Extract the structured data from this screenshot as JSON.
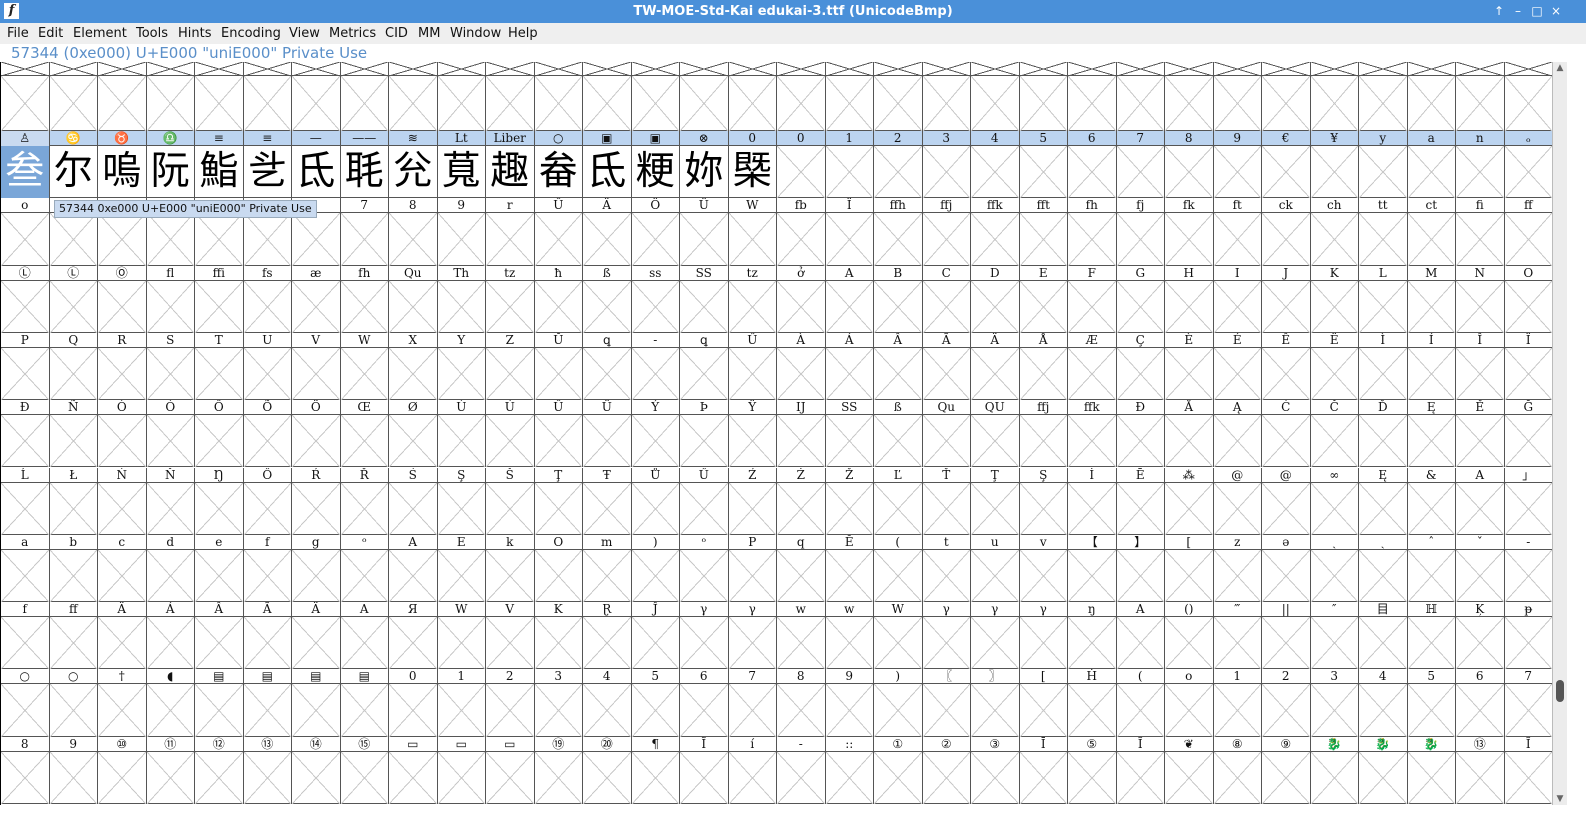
{
  "window": {
    "title": "TW-MOE-Std-Kai  edukai-3.ttf (UnicodeBmp)",
    "app_icon": "f",
    "controls": [
      "↑",
      "–",
      "□",
      "×"
    ]
  },
  "menu": [
    "File",
    "Edit",
    "Element",
    "Tools",
    "Hints",
    "Encoding",
    "View",
    "Metrics",
    "CID",
    "MM",
    "Window",
    "Help"
  ],
  "info_line": "57344 (0xe000) U+E000 \"uniE000\" Private Use",
  "tooltip": "57344 0xe000 U+E000 \"uniE000\" Private Use",
  "selection": {
    "row": 0,
    "col": 0
  },
  "rows": [
    {
      "labels": [
        "♙",
        "♋",
        "♉",
        "♎",
        "≡",
        "≡",
        "—",
        "——",
        "≋",
        "Lt",
        "Liber",
        "○",
        "▣",
        "▣",
        "⊗",
        "0",
        "0",
        "1",
        "2",
        "3",
        "4",
        "5",
        "6",
        "7",
        "8",
        "9",
        "€",
        "¥",
        "y",
        "a",
        "n",
        "ₒ"
      ],
      "glyphs": [
        "叁",
        "尔",
        "嗚",
        "阮",
        "鮨",
        "乧",
        "氐",
        "毦",
        "兊",
        "萈",
        "趣",
        "畚",
        "氐",
        "粳",
        "妳",
        "槩",
        "",
        "",
        "",
        "",
        "",
        "",
        "",
        "",
        "",
        "",
        "",
        "",
        "",
        "",
        "",
        ""
      ]
    },
    {
      "labels": [
        "o",
        "",
        "",
        "",
        "",
        "",
        "",
        "7",
        "8",
        "9",
        "r",
        "Û",
        "Ä",
        "Ö",
        "Ü",
        "W",
        "fb",
        "Ï",
        "ffh",
        "ffj",
        "ffk",
        "fft",
        "fh",
        "fj",
        "fk",
        "ft",
        "ck",
        "ch",
        "tt",
        "ct",
        "fi",
        "ff"
      ]
    },
    {
      "labels": [
        "Ⓛ",
        "Ⓛ",
        "Ⓞ",
        "fl",
        "ffi",
        "fs",
        "æ",
        "fh",
        "Qu",
        "Th",
        "tz",
        "ħ",
        "ß",
        "ss",
        "SS",
        "tz",
        "ở",
        "A",
        "B",
        "C",
        "D",
        "E",
        "F",
        "G",
        "H",
        "I",
        "J",
        "K",
        "L",
        "M",
        "N",
        "O"
      ]
    },
    {
      "labels": [
        "P",
        "Q",
        "R",
        "S",
        "T",
        "U",
        "V",
        "W",
        "X",
        "Y",
        "Z",
        "Ŭ",
        "ꝗ",
        "-",
        "ꝗ",
        "Ű",
        "À",
        "Á",
        "Â",
        "Ã",
        "Ä",
        "Å",
        "Æ",
        "Ç",
        "È",
        "É",
        "Ê",
        "Ë",
        "Ì",
        "Í",
        "Î",
        "Ï"
      ]
    },
    {
      "labels": [
        "Ð",
        "Ñ",
        "Ò",
        "Ó",
        "Ô",
        "Õ",
        "Ö",
        "Œ",
        "Ø",
        "Ù",
        "Ú",
        "Û",
        "Ü",
        "Ý",
        "Þ",
        "Ÿ",
        "IJ",
        "SS",
        "ß",
        "Qu",
        "QU",
        "ffj",
        "ffk",
        "Đ",
        "Ă",
        "Ą",
        "Ć",
        "Č",
        "Ď",
        "Ę",
        "Ě",
        "Ğ"
      ]
    },
    {
      "labels": [
        "Ĺ",
        "Ł",
        "Ń",
        "Ň",
        "Ŋ",
        "Ő",
        "Ŕ",
        "Ř",
        "Ś",
        "Ş",
        "Š",
        "Ţ",
        "Ŧ",
        "Ů",
        "Ű",
        "Ź",
        "Ż",
        "Ž",
        "Ľ",
        "Ť",
        "Ţ",
        "Ş",
        "İ",
        "Ē",
        "⁂",
        "@",
        "@",
        "∞",
        "Ę",
        "&",
        "A",
        "」"
      ]
    },
    {
      "labels": [
        "a",
        "b",
        "c",
        "d",
        "e",
        "f",
        "g",
        "ᵒ",
        "A",
        "E",
        "k",
        "O",
        "m",
        ")",
        "ᵒ",
        "P",
        "q",
        "Ĕ",
        "(",
        "t",
        "u",
        "v",
        "【",
        "】",
        "[",
        "z",
        "ə",
        "ˎ",
        "ˏ",
        "ˆ",
        "ˇ",
        "-"
      ]
    },
    {
      "labels": [
        "f",
        "ff",
        "Ä",
        "Á",
        "Â",
        "Ã",
        "Ä",
        "A",
        "Я",
        "W",
        "V",
        "K",
        "Ɽ",
        "Ĵ",
        "γ",
        "γ",
        "w",
        "w",
        "W",
        "γ",
        "γ",
        "γ",
        "ŋ",
        "A",
        "()",
        "‴",
        "||",
        "″",
        "目",
        "ℍ",
        "Ķ",
        "ᵽ"
      ]
    },
    {
      "labels": [
        "○",
        "○",
        "†",
        "◖",
        "▤",
        "▤",
        "▤",
        "▤",
        "0",
        "1",
        "2",
        "3",
        "4",
        "5",
        "6",
        "7",
        "8",
        "9",
        ")",
        "〖",
        "〗",
        "[",
        "Ḣ",
        "(",
        "o",
        "1",
        "2",
        "3",
        "4",
        "5",
        "6",
        "7"
      ]
    },
    {
      "labels": [
        "8",
        "9",
        "⑩",
        "⑪",
        "⑫",
        "⑬",
        "⑭",
        "⑮",
        "▭",
        "▭",
        "▭",
        "⑲",
        "⑳",
        "¶",
        "Ĩ",
        "í",
        "-",
        "::",
        "①",
        "②",
        "③",
        "Ī",
        "⑤",
        "Ĩ",
        "❦",
        "⑧",
        "⑨",
        "🐉",
        "🐉",
        "🐉",
        "⑬",
        "Ĩ"
      ]
    }
  ]
}
